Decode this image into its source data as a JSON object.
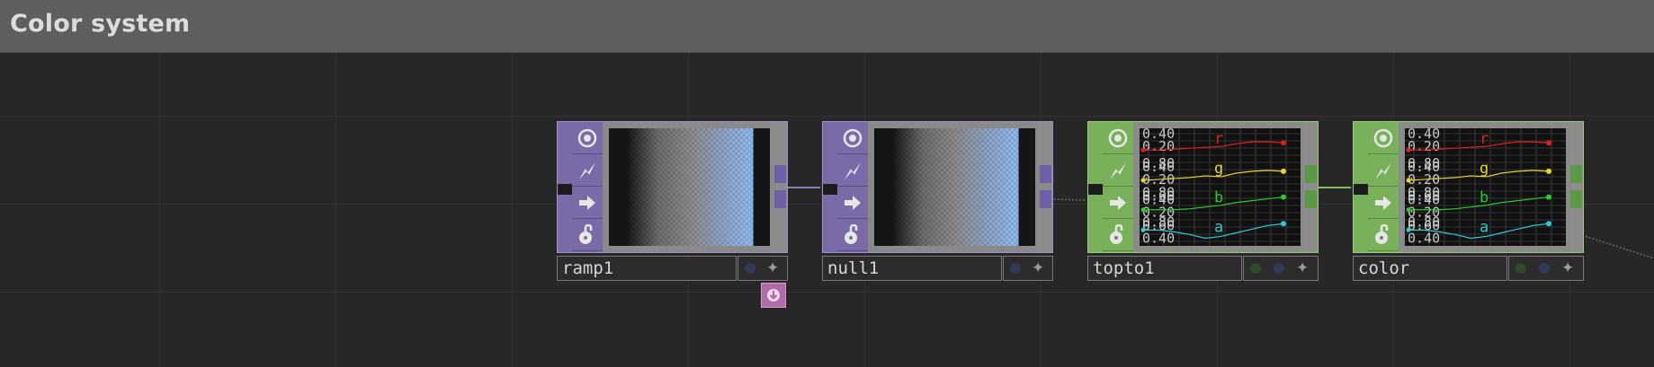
{
  "header": {
    "title": "Color system"
  },
  "colors": {
    "top_operator": "#7a6aa8",
    "chop_operator": "#78b15a",
    "background": "#272727",
    "header": "#5e5e5e"
  },
  "nodes": [
    {
      "id": "ramp1",
      "name": "ramp1",
      "family": "TOP",
      "viewer": "ramp"
    },
    {
      "id": "null1",
      "name": "null1",
      "family": "TOP",
      "viewer": "ramp"
    },
    {
      "id": "topto1",
      "name": "topto1",
      "family": "CHOP",
      "viewer": "channels"
    },
    {
      "id": "color",
      "name": "color",
      "family": "CHOP",
      "viewer": "channels"
    }
  ],
  "node_buttons": [
    "viewer-toggle-icon",
    "cook-icon",
    "bypass-arrow-icon",
    "lock-icon"
  ],
  "channel_viewer": {
    "channels": [
      {
        "name": "r",
        "color": "#e01f1f",
        "labels": [
          "0.40",
          "0.20"
        ]
      },
      {
        "name": "g",
        "color": "#e6d62c",
        "labels": [
          "0.80",
          "0.40",
          "0.20"
        ]
      },
      {
        "name": "b",
        "color": "#2ccb2c",
        "labels": [
          "0.80",
          "0.60",
          "0.40",
          "0.20"
        ]
      },
      {
        "name": "a",
        "color": "#2ccbd6",
        "labels": [
          "0.80",
          "0.60",
          "0.40"
        ]
      }
    ]
  },
  "chart_data": {
    "type": "line",
    "title": "",
    "xlabel": "",
    "ylabel": "",
    "series": [
      {
        "name": "r",
        "values": [
          0.22,
          0.22,
          0.24,
          0.26,
          0.28,
          0.3,
          0.36,
          0.4,
          0.4,
          0.38
        ]
      },
      {
        "name": "g",
        "values": [
          0.2,
          0.22,
          0.24,
          0.26,
          0.3,
          0.28,
          0.36,
          0.4,
          0.42,
          0.4
        ]
      },
      {
        "name": "b",
        "values": [
          0.2,
          0.2,
          0.2,
          0.22,
          0.26,
          0.3,
          0.36,
          0.4,
          0.44,
          0.48
        ]
      },
      {
        "name": "a",
        "values": [
          0.4,
          0.4,
          0.36,
          0.3,
          0.22,
          0.26,
          0.34,
          0.42,
          0.5,
          0.54
        ]
      }
    ]
  }
}
